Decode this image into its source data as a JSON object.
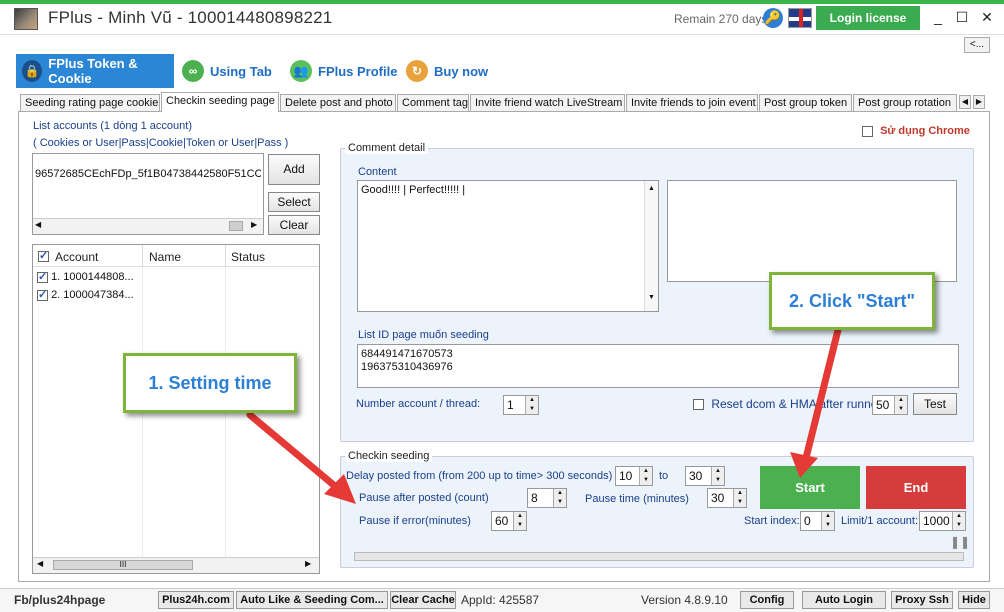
{
  "window": {
    "title": "FPlus - Minh Vũ - 100014480898221",
    "remain": "Remain 270 days",
    "login_label": "Login license",
    "minimize": "_",
    "maximize": "☐",
    "close": "✕",
    "collapse": "<..."
  },
  "main_tabs": [
    {
      "label": "FPlus Token & Cookie"
    },
    {
      "label": "Using Tab"
    },
    {
      "label": "FPlus Profile"
    },
    {
      "label": "Buy now"
    }
  ],
  "sub_tabs": [
    {
      "label": "Seeding rating page cookie"
    },
    {
      "label": "Checkin seeding page"
    },
    {
      "label": "Delete post and photo"
    },
    {
      "label": "Comment tag"
    },
    {
      "label": "Invite friend watch LiveStream"
    },
    {
      "label": "Invite friends to join event"
    },
    {
      "label": "Post group token"
    },
    {
      "label": "Post group rotation"
    }
  ],
  "accounts": {
    "label_1": "List accounts (1 dòng 1 account)",
    "label_2": "( Cookies or User|Pass|Cookie|Token or User|Pass )",
    "input_value": "96572685CEchFDp_5f1B04738442580F51CC;",
    "add": "Add",
    "select": "Select",
    "clear": "Clear",
    "columns": [
      "Account",
      "Name",
      "Status"
    ],
    "rows": [
      {
        "account": "1. 1000144808...",
        "checked": true
      },
      {
        "account": "2. 1000047384...",
        "checked": true
      }
    ],
    "scroll_thumb": "III"
  },
  "chrome": {
    "label": "Sử dụng Chrome"
  },
  "comment": {
    "group_title": "Comment detail",
    "content_label": "Content",
    "content_value": "Good!!!! | Perfect!!!!! |",
    "list_id_label": "List ID page muốn seeding",
    "list_ids": [
      "684491471670573",
      "196375310436976"
    ],
    "num_thread_label": "Number account / thread:",
    "num_thread_value": "1",
    "reset_label": "Reset dcom & HMA after runned",
    "reset_value": "50",
    "test": "Test"
  },
  "checkin": {
    "group_title": "Checkin seeding",
    "delay_label": "Delay posted from (from 200 up to time> 300 seconds)",
    "delay_from": "10",
    "to_label": "to",
    "delay_to": "30",
    "pause_after_label": "Pause after posted (count)",
    "pause_after_value": "8",
    "pause_time_label": "Pause time (minutes)",
    "pause_time_value": "30",
    "pause_error_label": "Pause if error(minutes)",
    "pause_error_value": "60",
    "start_index_label": "Start index:",
    "start_index_value": "0",
    "limit_label": "Limit/1 account:",
    "limit_value": "1000",
    "start": "Start",
    "end": "End",
    "pause_icon": "❚❚"
  },
  "callouts": {
    "step1": "1. Setting time",
    "step2": "2. Click \"Start\""
  },
  "status": {
    "page": "Fb/plus24hpage",
    "btn1": "Plus24h.com",
    "btn2": "Auto Like & Seeding Com...",
    "btn3": "Clear Cache",
    "appid": "AppId: 425587",
    "version": "Version 4.8.9.10",
    "config": "Config",
    "auto_login": "Auto Login",
    "proxy": "Proxy Ssh",
    "hide": "Hide"
  },
  "colors": {
    "accent": "#2b86d6",
    "start": "#4caf50",
    "end": "#d63c3c",
    "callout_border": "#7fb33a",
    "arrow": "#e53935"
  }
}
